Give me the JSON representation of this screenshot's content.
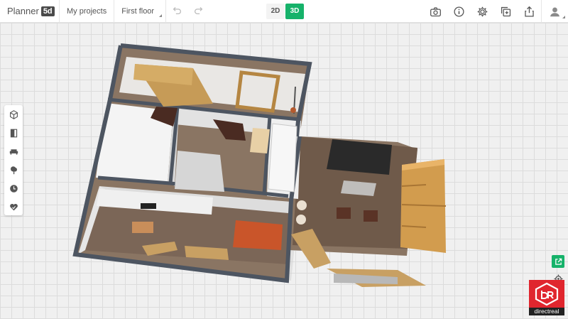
{
  "app": {
    "logo_text": "Planner",
    "logo_badge": "5d"
  },
  "header": {
    "my_projects": "My projects",
    "floor_selector": "First floor",
    "undo_icon": "undo-icon",
    "redo_icon": "redo-icon"
  },
  "view_modes": {
    "two_d": "2D",
    "three_d": "3D",
    "active": "3D",
    "active_color": "#16b26a"
  },
  "toolbar_icons": [
    "camera-icon",
    "info-icon",
    "gear-icon",
    "copy-add-icon",
    "share-icon",
    "user-avatar-icon"
  ],
  "sidebar_icons": [
    "construction-icon",
    "doors-icon",
    "furniture-icon",
    "exterior-icon",
    "history-icon",
    "favorites-icon"
  ],
  "branding": {
    "watermark_text": "directreal",
    "color": "#e0262e"
  }
}
